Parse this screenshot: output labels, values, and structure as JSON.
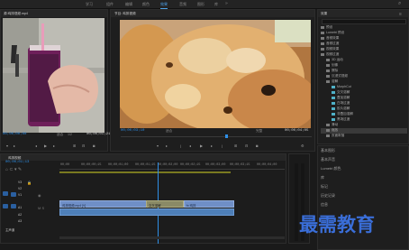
{
  "workspaces": [
    "学习",
    "组件",
    "编辑",
    "颜色",
    "效果",
    "音频",
    "图形",
    "库"
  ],
  "workspace_active": 4,
  "source_monitor": {
    "title": "源:鸡排视频.mp4",
    "zoom": "适合",
    "page": "1/2",
    "timecode_in": "00;00;00;00",
    "timecode_dur": "00;00;01;21"
  },
  "program_monitor": {
    "title": "节目: 鸡排视频",
    "timecode": "00;00;03;10",
    "zoom": "适合",
    "quality": "完整",
    "duration": "00;00;04;05"
  },
  "project_panel": {
    "title": "效果",
    "search_placeholder": "",
    "tree": [
      {
        "label": "预设",
        "type": "folder",
        "indent": 0
      },
      {
        "label": "Lumetri 预设",
        "type": "folder",
        "indent": 0
      },
      {
        "label": "音频效果",
        "type": "folder",
        "indent": 0
      },
      {
        "label": "音频过渡",
        "type": "folder",
        "indent": 0
      },
      {
        "label": "视频效果",
        "type": "folder",
        "indent": 0
      },
      {
        "label": "视频过渡",
        "type": "folder",
        "indent": 0
      },
      {
        "label": "3D 运动",
        "type": "folder",
        "indent": 1
      },
      {
        "label": "划像",
        "type": "folder",
        "indent": 1
      },
      {
        "label": "擦除",
        "type": "folder",
        "indent": 1
      },
      {
        "label": "沉浸式视频",
        "type": "folder",
        "indent": 1
      },
      {
        "label": "溶解",
        "type": "folder",
        "indent": 1
      },
      {
        "label": "MorphCut",
        "type": "clip",
        "indent": 2
      },
      {
        "label": "交叉溶解",
        "type": "clip",
        "indent": 2
      },
      {
        "label": "叠加溶解",
        "type": "clip",
        "indent": 2
      },
      {
        "label": "白场过渡",
        "type": "clip",
        "indent": 2
      },
      {
        "label": "胶片溶解",
        "type": "clip",
        "indent": 2
      },
      {
        "label": "非叠加溶解",
        "type": "clip",
        "indent": 2
      },
      {
        "label": "黑场过渡",
        "type": "clip",
        "indent": 2
      },
      {
        "label": "滑动",
        "type": "folder",
        "indent": 1
      },
      {
        "label": "缩放",
        "type": "folder",
        "indent": 1
      },
      {
        "label": "页面剥落",
        "type": "folder",
        "indent": 1
      }
    ],
    "selected_index": 17
  },
  "effects_panel": {
    "items": [
      "基本图形",
      "基本声音",
      "Lumetri 颜色",
      "库",
      "标记",
      "历史记录",
      "信息"
    ]
  },
  "timeline": {
    "title": "鸡排视频",
    "timecode": "00;00;01;13",
    "ruler": [
      "00;00",
      "00;00;00;15",
      "00;00;01;00",
      "00;00;01;15",
      "00;00;02;00",
      "00;00;02;15",
      "00;00;03;00",
      "00;00;03;15",
      "00;00;04;00"
    ],
    "tracks": [
      "V3",
      "V2",
      "V1",
      "A1",
      "A2",
      "A3"
    ],
    "clip_v1": "鸡排视频.mp4 [V]",
    "clip_fx": "交叉溶解",
    "clip_v1b": "fx 鸡排",
    "master": "主声道"
  },
  "watermark": "最需教育",
  "colors": {
    "accent": "#4ea2e8",
    "timecode": "#2f8fe6"
  }
}
